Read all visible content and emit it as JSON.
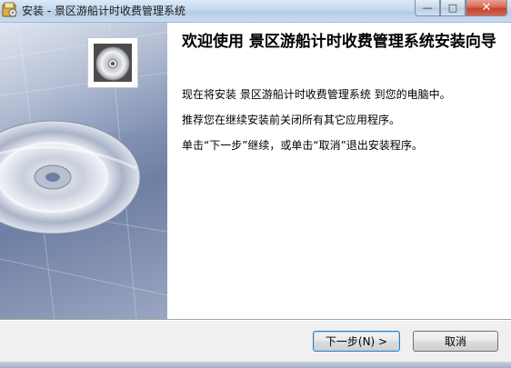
{
  "window": {
    "title": "安装 - 景区游船计时收费管理系统",
    "controls": {
      "minimize": "—",
      "maximize": "□",
      "close": "✕"
    }
  },
  "content": {
    "heading": "欢迎使用 景区游船计时收费管理系统安装向导",
    "paragraphs": [
      "现在将安装 景区游船计时收费管理系统 到您的电脑中。",
      "推荐您在继续安装前关闭所有其它应用程序。",
      "单击“下一步”继续，或单击“取消”退出安装程序。"
    ]
  },
  "buttons": {
    "next": "下一步(N) >",
    "cancel": "取消"
  },
  "icons": {
    "app": "installer-app-icon",
    "banner": "cd-disc-banner",
    "thumb": "cd-disc-thumbnail"
  },
  "colors": {
    "titlebar": "#c3d8ee",
    "banner_bg": "#7f8fb0",
    "close_button": "#c4442b",
    "content_bg": "#ffffff"
  }
}
